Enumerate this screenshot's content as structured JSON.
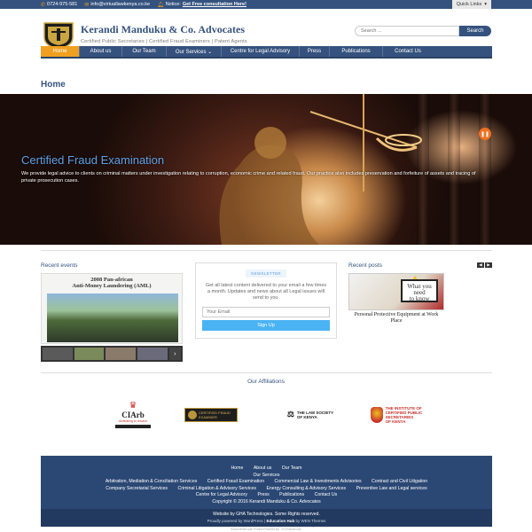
{
  "topbar": {
    "phone": "0724-975-581",
    "email": "info@virtuallawkenya.co.ke",
    "notice_label": "Notice:",
    "notice_link": "Get Free consultation Here!",
    "quick_links": "Quick Links"
  },
  "header": {
    "firm_name": "Kerandi Manduku & Co. Advocates",
    "tagline": "Certified Public Secretaries | Certified Fraud Examiners | Patent Agents",
    "search_placeholder": "Search ...",
    "search_button": "Search"
  },
  "nav": {
    "items": [
      {
        "label": "Home"
      },
      {
        "label": "About us"
      },
      {
        "label": "Our Team"
      },
      {
        "label": "Our Services ⌄"
      },
      {
        "label": "Centre for Legal Advisory"
      },
      {
        "label": "Press"
      },
      {
        "label": "Publications"
      },
      {
        "label": "Contact Us"
      }
    ]
  },
  "page": {
    "title": "Home"
  },
  "hero": {
    "title": "Certified Fraud Examination",
    "description": "We provide legal advice to clients on criminal matters under investigation relating to corruption, economic crime and related fraud. Our practice also includes preservation and forfeiture of assets and tracing of private prosecution cases."
  },
  "events": {
    "heading": "Recent events",
    "image_title_1": "2008 Pan-african",
    "image_title_2": "Anti-Money Laundering (AML)"
  },
  "newsletter": {
    "badge": "NEWSLETTER",
    "text": "Get all latest content delivered to your email a few times a month. Updates and news about all Legal issues will send to you.",
    "email_placeholder": "Your Email",
    "signup": "Sign Up"
  },
  "posts": {
    "heading": "Recent posts",
    "sign_text_1": "What you need",
    "sign_text_2": "to know",
    "caption": "Personal Protective Equipment at Work Place"
  },
  "affiliations": {
    "heading": "Our Affiliations",
    "ciarb": "CIArb",
    "ciarb_sub": "Arbitrating to resolve",
    "cfe_1": "CERTIFIED FRAUD",
    "cfe_2": "EXAMINER",
    "lsk_1": "THE LAW SOCIETY",
    "lsk_2": "OF KENYA",
    "icps_1": "THE INSTITUTE OF",
    "icps_2": "CERTIFIED PUBLIC",
    "icps_3": "SECRETARIES",
    "icps_4": "OF KENYA"
  },
  "footer": {
    "row1": [
      "Home",
      "About us",
      "Our Team"
    ],
    "row2": [
      "Our Services"
    ],
    "row3": [
      "Arbitration, Mediation & Conciliation Services",
      "Certified Fraud Examination",
      "Commercial Law & Investments Advisories",
      "Contract and Civil Litigation"
    ],
    "row4": [
      "Company Secretarial Services",
      "Criminal Litigation & Advisory Services",
      "Energy Consulting & Advisory Services",
      "Preventive Law and Legal services"
    ],
    "row5": [
      "Centre for Legal Advisory",
      "Press",
      "Publications",
      "Contact Us"
    ],
    "copyright": "Copyright © 2016 Kerandi Manduku & Co. Advocates",
    "website_by": "Website by GHA Technologies. Some Rights reserved.",
    "powered_prefix": "Proudly powered by WordPress |",
    "powered_theme": "Education Hub",
    "powered_suffix": "by WEN Themes",
    "tiny": "Social Media Auto Publish Powered By : XYZScripts.com"
  },
  "colors": {
    "brand": "#35527e",
    "accent": "#f0a020",
    "hero_title": "#5ea0e6",
    "signup": "#4ab3f4"
  }
}
